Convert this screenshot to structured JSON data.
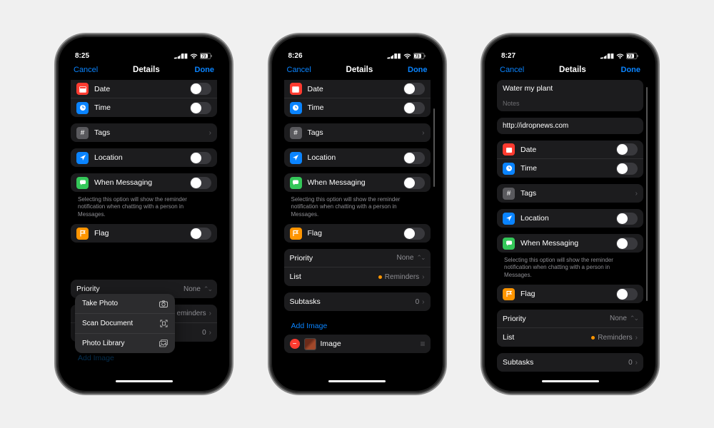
{
  "phones": [
    {
      "time": "8:25",
      "battery": "73",
      "nav": {
        "cancel": "Cancel",
        "title": "Details",
        "done": "Done"
      },
      "rows": {
        "date": "Date",
        "timeRow": "Time",
        "tags": "Tags",
        "location": "Location",
        "messaging": "When Messaging",
        "messagingHint": "Selecting this option will show the reminder notification when chatting with a person in Messages.",
        "flag": "Flag",
        "priority": "Priority",
        "priorityValue": "None",
        "list": "",
        "listValue": "eminders",
        "subtasks": "",
        "subtasksValue": "0",
        "addImage": "Add Image"
      },
      "menu": {
        "takePhoto": "Take Photo",
        "scanDocument": "Scan Document",
        "photoLibrary": "Photo Library"
      }
    },
    {
      "time": "8:26",
      "battery": "73",
      "nav": {
        "cancel": "Cancel",
        "title": "Details",
        "done": "Done"
      },
      "rows": {
        "date": "Date",
        "timeRow": "Time",
        "tags": "Tags",
        "location": "Location",
        "messaging": "When Messaging",
        "messagingHint": "Selecting this option will show the reminder notification when chatting with a person in Messages.",
        "flag": "Flag",
        "priority": "Priority",
        "priorityValue": "None",
        "list": "List",
        "listValue": "Reminders",
        "subtasks": "Subtasks",
        "subtasksValue": "0",
        "addImage": "Add Image",
        "imageLabel": "Image"
      }
    },
    {
      "time": "8:27",
      "battery": "73",
      "nav": {
        "cancel": "Cancel",
        "title": "Details",
        "done": "Done"
      },
      "rows": {
        "titleText": "Water my plant",
        "notes": "Notes",
        "url": "http://idropnews.com",
        "date": "Date",
        "timeRow": "Time",
        "tags": "Tags",
        "location": "Location",
        "messaging": "When Messaging",
        "messagingHint": "Selecting this option will show the reminder notification when chatting with a person in Messages.",
        "flag": "Flag",
        "priority": "Priority",
        "priorityValue": "None",
        "list": "List",
        "listValue": "Reminders",
        "subtasks": "Subtasks",
        "subtasksValue": "0"
      }
    }
  ]
}
